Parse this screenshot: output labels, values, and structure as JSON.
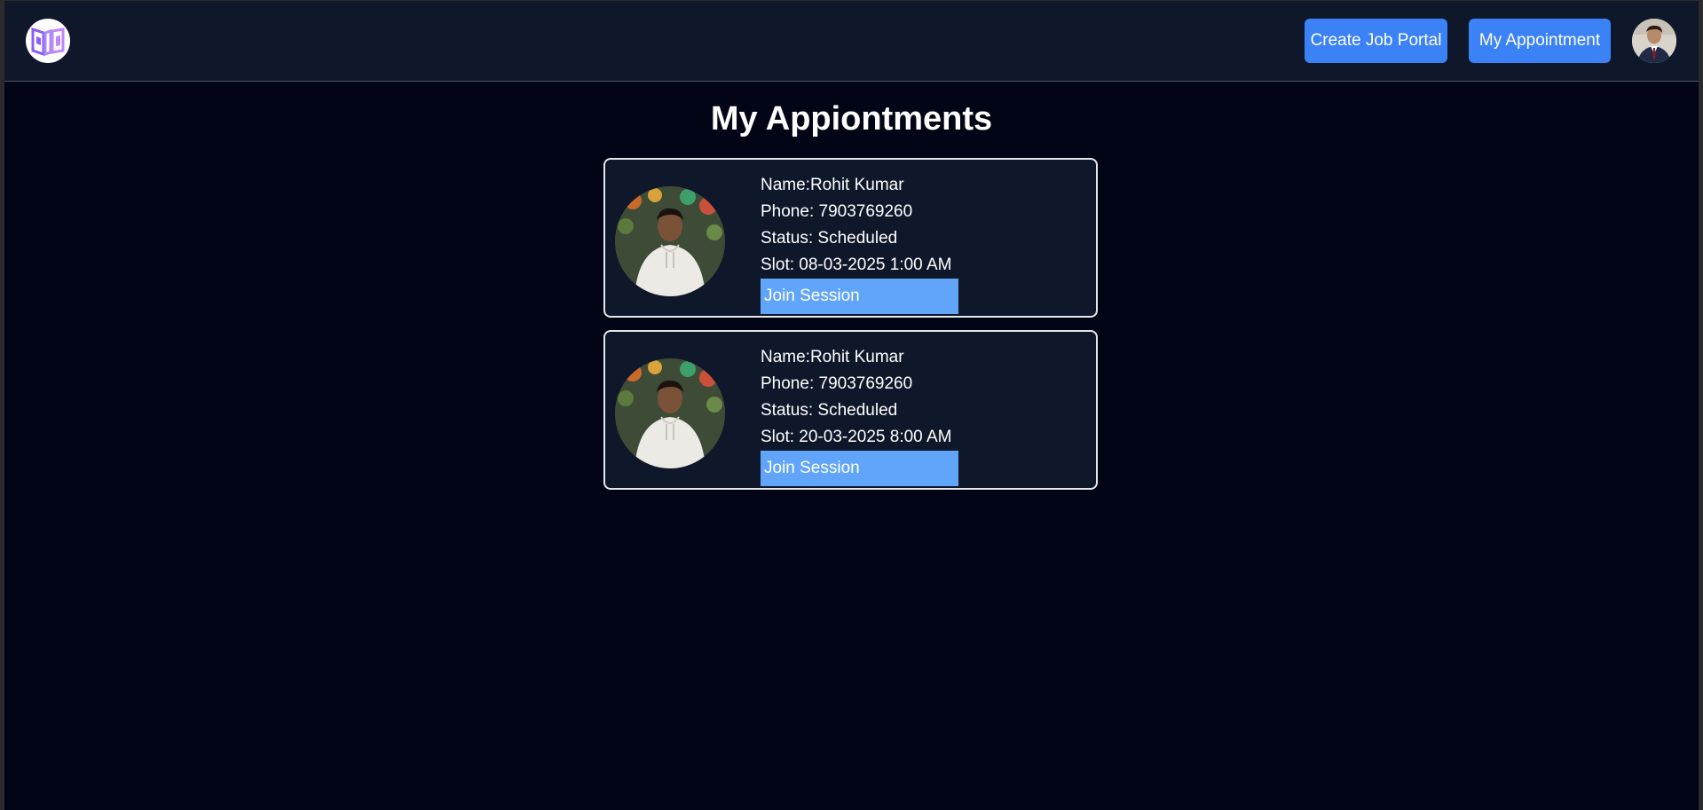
{
  "navbar": {
    "logo_icon": "book-logo-icon",
    "create_job_portal_label": "Create Job Portal",
    "my_appointment_label": "My Appointment",
    "profile_icon": "user-avatar",
    "accent_color": "#3b82f6"
  },
  "page": {
    "title": "My Appiontments"
  },
  "appointments": [
    {
      "name": "Name:Rohit Kumar",
      "phone": "Phone: 7903769260",
      "status": "Status: Scheduled",
      "slot": "Slot: 08-03-2025 1:00 AM",
      "join_label": "Join Session"
    },
    {
      "name": "Name:Rohit Kumar",
      "phone": "Phone: 7903769260",
      "status": "Status: Scheduled",
      "slot": "Slot: 20-03-2025 8:00 AM",
      "join_label": "Join Session"
    }
  ],
  "colors": {
    "background": "#010515",
    "navbar": "#0f172a",
    "card": "#0f172a",
    "join_button": "#60a5fa"
  }
}
